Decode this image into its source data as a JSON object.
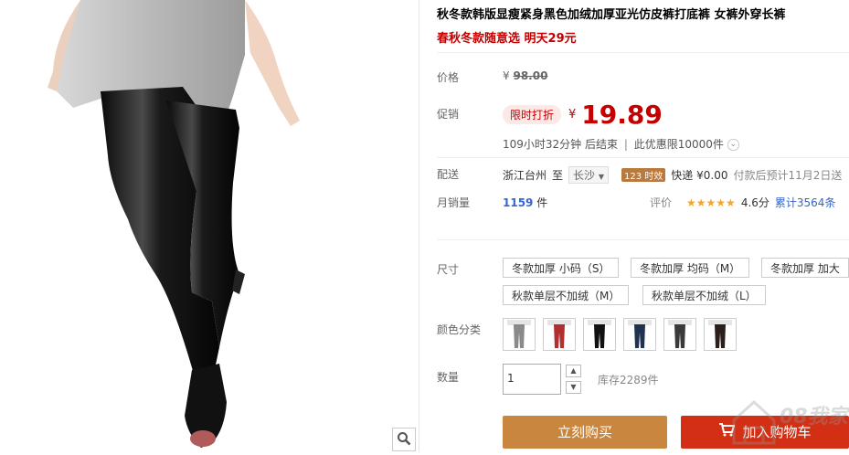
{
  "product": {
    "title": "秋冬款韩版显瘦紧身黑色加绒加厚亚光仿皮裤打底裤 女裤外穿长裤",
    "subtitle": "春秋冬款随意选 明天29元"
  },
  "price": {
    "label": "价格",
    "currency": "¥",
    "original": "98.00"
  },
  "promo": {
    "label": "促销",
    "tag": "限时打折",
    "currency": "¥",
    "price": "19.89",
    "countdown": "109小时32分钟 后结束",
    "limit": "此优惠限10000件"
  },
  "shipping": {
    "label": "配送",
    "from": "浙江台州",
    "to_word": "至",
    "dest": "长沙",
    "badge": "123 时效",
    "method": "快递 ¥0.00",
    "eta": "付款后预计11月2日送"
  },
  "sales": {
    "label": "月销量",
    "count": "1159",
    "unit": "件"
  },
  "rating": {
    "label": "评价",
    "stars": "★★★★★",
    "score": "4.6分",
    "count_link": "累计3564条"
  },
  "size": {
    "label": "尺寸",
    "options": [
      "冬款加厚 小码（S）",
      "冬款加厚 均码（M）",
      "冬款加厚 加大",
      "秋款单层不加绒（M）",
      "秋款单层不加绒（L）"
    ]
  },
  "color": {
    "label": "颜色分类",
    "swatch_colors": [
      "#8a8a8a",
      "#b03030",
      "#111111",
      "#1f3350",
      "#3a3a3a",
      "#2a1f1a"
    ]
  },
  "quantity": {
    "label": "数量",
    "value": "1",
    "stock": "库存2289件"
  },
  "actions": {
    "buy_now": "立刻购买",
    "add_to_cart": "加入购物车"
  },
  "watermark": "08我家"
}
